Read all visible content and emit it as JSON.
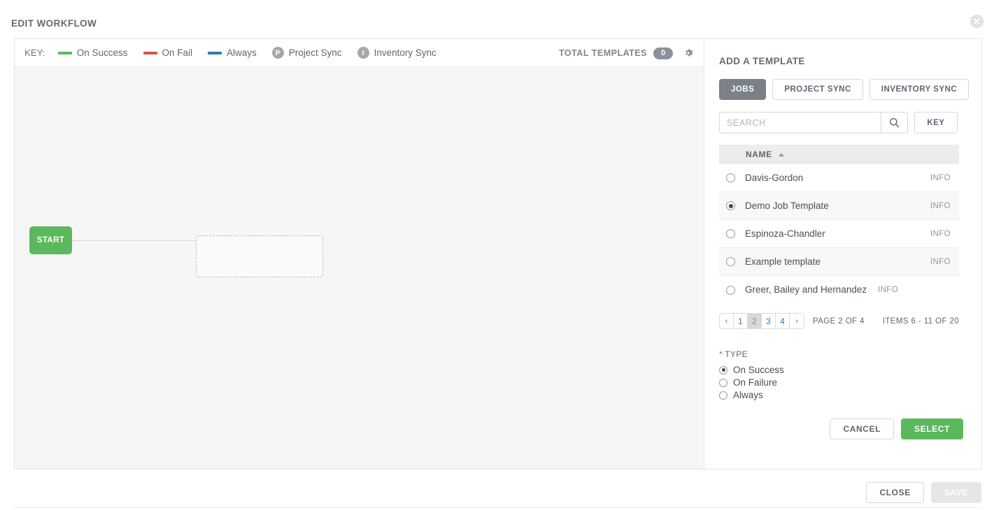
{
  "dialog": {
    "title": "EDIT WORKFLOW",
    "close_icon": "close-circle-icon"
  },
  "key_bar": {
    "label": "KEY:",
    "legend": [
      {
        "label": "On Success",
        "kind": "line",
        "color": "#5cb85c"
      },
      {
        "label": "On Fail",
        "kind": "line",
        "color": "#d9534f"
      },
      {
        "label": "Always",
        "kind": "line",
        "color": "#337ab7"
      },
      {
        "label": "Project Sync",
        "kind": "circle",
        "glyph": "P",
        "color": "#a4a8ad"
      },
      {
        "label": "Inventory Sync",
        "kind": "circle",
        "glyph": "I",
        "color": "#a4a8ad"
      }
    ],
    "total_label": "TOTAL TEMPLATES",
    "total_count": "0",
    "gear_icon": "gear-icon"
  },
  "canvas": {
    "start_label": "START"
  },
  "panel": {
    "title": "ADD A TEMPLATE",
    "tabs": [
      {
        "label": "JOBS",
        "active": true
      },
      {
        "label": "PROJECT SYNC",
        "active": false
      },
      {
        "label": "INVENTORY SYNC",
        "active": false
      }
    ],
    "search": {
      "placeholder": "SEARCH",
      "value": "",
      "search_icon": "search-icon",
      "key_button": "KEY"
    },
    "table": {
      "column": "NAME",
      "sort": "asc",
      "info_label": "INFO",
      "rows": [
        {
          "name": "Davis-Gordon",
          "selected": false
        },
        {
          "name": "Demo Job Template",
          "selected": true
        },
        {
          "name": "Espinoza-Chandler",
          "selected": false
        },
        {
          "name": "Example template",
          "selected": false
        },
        {
          "name": "Greer, Bailey and Hernandez",
          "selected": false
        }
      ]
    },
    "pagination": {
      "prev": "‹",
      "next": "›",
      "pages": [
        "1",
        "2",
        "3",
        "4"
      ],
      "current": "2",
      "page_text": "PAGE 2 OF 4",
      "items_text": "ITEMS  6 - 11 OF 20"
    },
    "type": {
      "label": "TYPE",
      "required_mark": "*",
      "options": [
        {
          "label": "On Success",
          "selected": true
        },
        {
          "label": "On Failure",
          "selected": false
        },
        {
          "label": "Always",
          "selected": false
        }
      ]
    },
    "actions": {
      "cancel": "CANCEL",
      "select": "SELECT"
    }
  },
  "footer": {
    "close": "CLOSE",
    "save": "SAVE"
  }
}
